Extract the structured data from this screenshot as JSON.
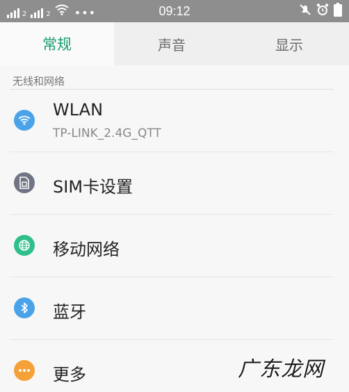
{
  "status_bar": {
    "time": "09:12",
    "network_type_1": "2",
    "network_type_2": "2",
    "more_dots": "•••",
    "icons": [
      "signal-icon",
      "signal-icon",
      "wifi-icon",
      "no-notification-icon",
      "alarm-icon",
      "battery-icon"
    ]
  },
  "tabs": [
    {
      "label": "常规",
      "selected": true
    },
    {
      "label": "声音",
      "selected": false
    },
    {
      "label": "显示",
      "selected": false
    }
  ],
  "section": {
    "header": "无线和网络"
  },
  "items": [
    {
      "title": "WLAN",
      "subtitle": "TP-LINK_2.4G_QTT",
      "icon": "wifi-icon",
      "color": "#4aa3e8"
    },
    {
      "title": "SIM卡设置",
      "icon": "sim-card-icon",
      "color": "#6f7585"
    },
    {
      "title": "移动网络",
      "icon": "globe-icon",
      "color": "#2fbf8a"
    },
    {
      "title": "蓝牙",
      "icon": "bluetooth-icon",
      "color": "#4aa3e8"
    },
    {
      "title": "更多",
      "icon": "more-icon",
      "color": "#f5a138"
    }
  ],
  "colors": {
    "accent": "#1a9c6e",
    "status_bar": "#8e8e8e",
    "background": "#f7f7f7"
  },
  "watermark": "广东龙网"
}
